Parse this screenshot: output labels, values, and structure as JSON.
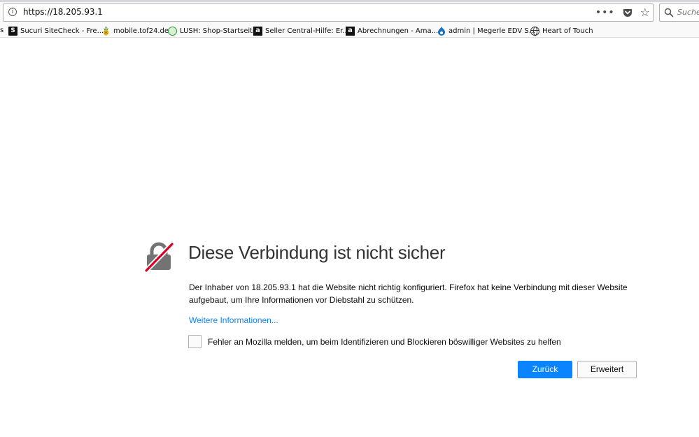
{
  "browser": {
    "url": "https://18.205.93.1",
    "page_actions_icon": "•••",
    "search_placeholder": "Suche",
    "bookmarks_edge_label": "s",
    "bookmarks": [
      {
        "label": "Sucuri SiteCheck - Fre...",
        "icon": "sucuri-icon",
        "icon_glyph": "S"
      },
      {
        "label": "mobile.tof24.de",
        "icon": "pineapple-icon"
      },
      {
        "label": "LUSH: Shop-Startseite",
        "icon": "lush-icon"
      },
      {
        "label": "Seller Central-Hilfe: Er...",
        "icon": "amazon-icon",
        "icon_glyph": "a"
      },
      {
        "label": "Abrechnungen - Ama...",
        "icon": "amazon-icon",
        "icon_glyph": "a"
      },
      {
        "label": "admin | Megerle EDV S...",
        "icon": "drupal-icon"
      },
      {
        "label": "Heart of Touch",
        "icon": "globe-icon"
      }
    ]
  },
  "error_page": {
    "title": "Diese Verbindung ist nicht sicher",
    "description": "Der Inhaber von 18.205.93.1 hat die Website nicht richtig konfiguriert. Firefox hat keine Verbindung mit dieser Website aufgebaut, um Ihre Informationen vor Diebstahl zu schützen.",
    "learn_more": "Weitere Informationen...",
    "report_label": "Fehler an Mozilla melden, um beim Identifizieren und Blockieren böswilliger Websites zu helfen",
    "report_checked": false,
    "back_button": "Zurück",
    "advanced_button": "Erweitert"
  },
  "colors": {
    "accent": "#0a84ff",
    "lock_slash": "#d70022",
    "lock_body": "#737373"
  }
}
